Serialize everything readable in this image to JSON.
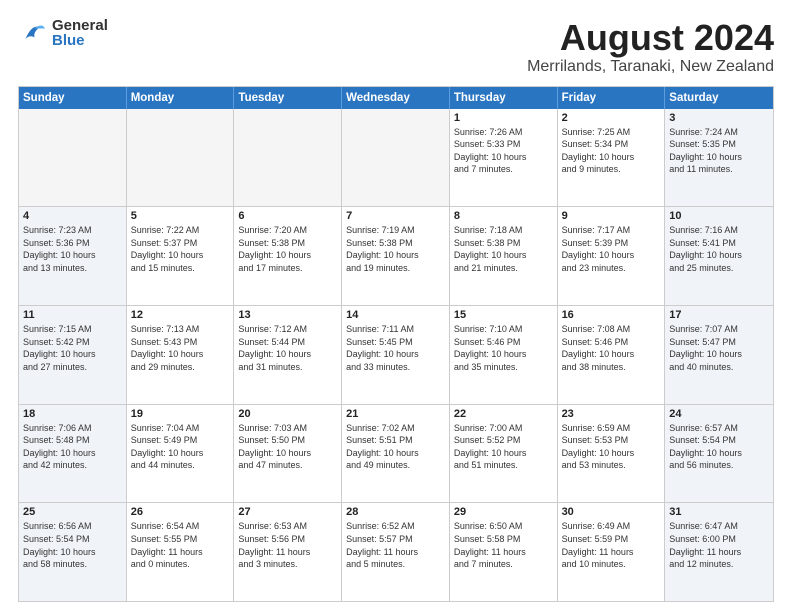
{
  "header": {
    "logo": {
      "general": "General",
      "blue": "Blue"
    },
    "title": "August 2024",
    "subtitle": "Merrilands, Taranaki, New Zealand"
  },
  "calendar": {
    "weekdays": [
      "Sunday",
      "Monday",
      "Tuesday",
      "Wednesday",
      "Thursday",
      "Friday",
      "Saturday"
    ],
    "rows": [
      [
        {
          "day": "",
          "info": "",
          "empty": true
        },
        {
          "day": "",
          "info": "",
          "empty": true
        },
        {
          "day": "",
          "info": "",
          "empty": true
        },
        {
          "day": "",
          "info": "",
          "empty": true
        },
        {
          "day": "1",
          "info": "Sunrise: 7:26 AM\nSunset: 5:33 PM\nDaylight: 10 hours\nand 7 minutes."
        },
        {
          "day": "2",
          "info": "Sunrise: 7:25 AM\nSunset: 5:34 PM\nDaylight: 10 hours\nand 9 minutes."
        },
        {
          "day": "3",
          "info": "Sunrise: 7:24 AM\nSunset: 5:35 PM\nDaylight: 10 hours\nand 11 minutes."
        }
      ],
      [
        {
          "day": "4",
          "info": "Sunrise: 7:23 AM\nSunset: 5:36 PM\nDaylight: 10 hours\nand 13 minutes."
        },
        {
          "day": "5",
          "info": "Sunrise: 7:22 AM\nSunset: 5:37 PM\nDaylight: 10 hours\nand 15 minutes."
        },
        {
          "day": "6",
          "info": "Sunrise: 7:20 AM\nSunset: 5:38 PM\nDaylight: 10 hours\nand 17 minutes."
        },
        {
          "day": "7",
          "info": "Sunrise: 7:19 AM\nSunset: 5:38 PM\nDaylight: 10 hours\nand 19 minutes."
        },
        {
          "day": "8",
          "info": "Sunrise: 7:18 AM\nSunset: 5:38 PM\nDaylight: 10 hours\nand 21 minutes."
        },
        {
          "day": "9",
          "info": "Sunrise: 7:17 AM\nSunset: 5:39 PM\nDaylight: 10 hours\nand 23 minutes."
        },
        {
          "day": "10",
          "info": "Sunrise: 7:16 AM\nSunset: 5:41 PM\nDaylight: 10 hours\nand 25 minutes."
        }
      ],
      [
        {
          "day": "11",
          "info": "Sunrise: 7:15 AM\nSunset: 5:42 PM\nDaylight: 10 hours\nand 27 minutes."
        },
        {
          "day": "12",
          "info": "Sunrise: 7:13 AM\nSunset: 5:43 PM\nDaylight: 10 hours\nand 29 minutes."
        },
        {
          "day": "13",
          "info": "Sunrise: 7:12 AM\nSunset: 5:44 PM\nDaylight: 10 hours\nand 31 minutes."
        },
        {
          "day": "14",
          "info": "Sunrise: 7:11 AM\nSunset: 5:45 PM\nDaylight: 10 hours\nand 33 minutes."
        },
        {
          "day": "15",
          "info": "Sunrise: 7:10 AM\nSunset: 5:46 PM\nDaylight: 10 hours\nand 35 minutes."
        },
        {
          "day": "16",
          "info": "Sunrise: 7:08 AM\nSunset: 5:46 PM\nDaylight: 10 hours\nand 38 minutes."
        },
        {
          "day": "17",
          "info": "Sunrise: 7:07 AM\nSunset: 5:47 PM\nDaylight: 10 hours\nand 40 minutes."
        }
      ],
      [
        {
          "day": "18",
          "info": "Sunrise: 7:06 AM\nSunset: 5:48 PM\nDaylight: 10 hours\nand 42 minutes."
        },
        {
          "day": "19",
          "info": "Sunrise: 7:04 AM\nSunset: 5:49 PM\nDaylight: 10 hours\nand 44 minutes."
        },
        {
          "day": "20",
          "info": "Sunrise: 7:03 AM\nSunset: 5:50 PM\nDaylight: 10 hours\nand 47 minutes."
        },
        {
          "day": "21",
          "info": "Sunrise: 7:02 AM\nSunset: 5:51 PM\nDaylight: 10 hours\nand 49 minutes."
        },
        {
          "day": "22",
          "info": "Sunrise: 7:00 AM\nSunset: 5:52 PM\nDaylight: 10 hours\nand 51 minutes."
        },
        {
          "day": "23",
          "info": "Sunrise: 6:59 AM\nSunset: 5:53 PM\nDaylight: 10 hours\nand 53 minutes."
        },
        {
          "day": "24",
          "info": "Sunrise: 6:57 AM\nSunset: 5:54 PM\nDaylight: 10 hours\nand 56 minutes."
        }
      ],
      [
        {
          "day": "25",
          "info": "Sunrise: 6:56 AM\nSunset: 5:54 PM\nDaylight: 10 hours\nand 58 minutes."
        },
        {
          "day": "26",
          "info": "Sunrise: 6:54 AM\nSunset: 5:55 PM\nDaylight: 11 hours\nand 0 minutes."
        },
        {
          "day": "27",
          "info": "Sunrise: 6:53 AM\nSunset: 5:56 PM\nDaylight: 11 hours\nand 3 minutes."
        },
        {
          "day": "28",
          "info": "Sunrise: 6:52 AM\nSunset: 5:57 PM\nDaylight: 11 hours\nand 5 minutes."
        },
        {
          "day": "29",
          "info": "Sunrise: 6:50 AM\nSunset: 5:58 PM\nDaylight: 11 hours\nand 7 minutes."
        },
        {
          "day": "30",
          "info": "Sunrise: 6:49 AM\nSunset: 5:59 PM\nDaylight: 11 hours\nand 10 minutes."
        },
        {
          "day": "31",
          "info": "Sunrise: 6:47 AM\nSunset: 6:00 PM\nDaylight: 11 hours\nand 12 minutes."
        }
      ]
    ]
  }
}
